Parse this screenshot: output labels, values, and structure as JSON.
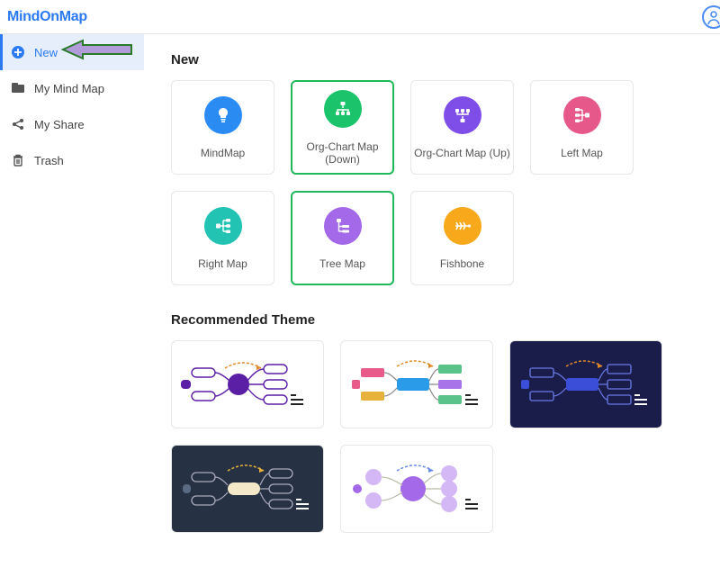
{
  "header": {
    "logo": "MindOnMap"
  },
  "sidebar": {
    "items": [
      {
        "label": "New",
        "active": true
      },
      {
        "label": "My Mind Map",
        "active": false
      },
      {
        "label": "My Share",
        "active": false
      },
      {
        "label": "Trash",
        "active": false
      }
    ]
  },
  "sections": {
    "new_title": "New",
    "themes_title": "Recommended Theme"
  },
  "templates": [
    {
      "label": "MindMap",
      "color": "bg-blue",
      "icon": "bulb"
    },
    {
      "label": "Org-Chart Map (Down)",
      "color": "bg-green",
      "icon": "org-down",
      "highlighted": true
    },
    {
      "label": "Org-Chart Map (Up)",
      "color": "bg-purple",
      "icon": "org-up"
    },
    {
      "label": "Left Map",
      "color": "bg-pink",
      "icon": "left"
    },
    {
      "label": "Right Map",
      "color": "bg-teal",
      "icon": "right"
    },
    {
      "label": "Tree Map",
      "color": "bg-violet",
      "icon": "tree",
      "highlighted": true
    },
    {
      "label": "Fishbone",
      "color": "bg-orange",
      "icon": "fish"
    }
  ]
}
